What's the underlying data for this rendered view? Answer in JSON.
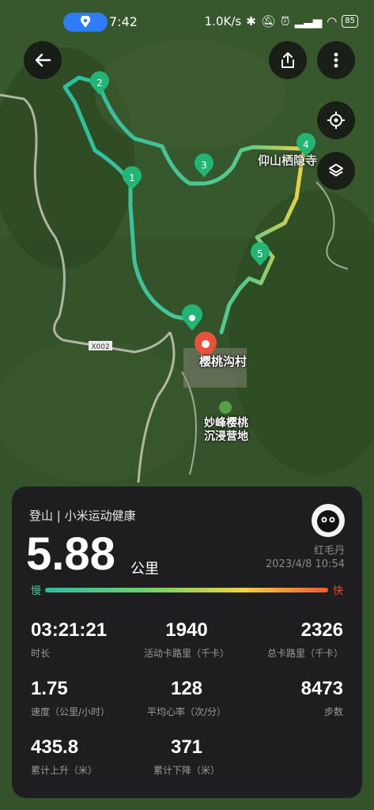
{
  "status": {
    "time": "7:42",
    "speed": "1.0K/s",
    "battery": "85"
  },
  "map": {
    "road_label": "X002",
    "village": "樱桃沟村",
    "camp_line1": "妙峰樱桃",
    "camp_line2": "沉浸营地",
    "temple": "仰山栖隐寺",
    "markers": [
      "1",
      "2",
      "3",
      "4",
      "5"
    ]
  },
  "summary": {
    "activity": "登山 | 小米运动健康",
    "distance": "5.88",
    "distance_unit": "公里",
    "username": "红毛丹",
    "datetime": "2023/4/8 10:54",
    "slow_label": "慢",
    "fast_label": "快"
  },
  "stats": [
    {
      "value": "03:21:21",
      "label": "时长"
    },
    {
      "value": "1940",
      "label": "活动卡路里（千卡）"
    },
    {
      "value": "2326",
      "label": "总卡路里（千卡）"
    },
    {
      "value": "1.75",
      "label": "速度（公里/小时）"
    },
    {
      "value": "128",
      "label": "平均心率（次/分）"
    },
    {
      "value": "8473",
      "label": "步数"
    },
    {
      "value": "435.8",
      "label": "累计上升（米）"
    },
    {
      "value": "371",
      "label": "累计下降（米）"
    }
  ],
  "colors": {
    "route_start": "#2bbea0",
    "route_mid": "#f1d240",
    "end_marker": "#e8523a",
    "card_bg": "#1e1e20"
  }
}
